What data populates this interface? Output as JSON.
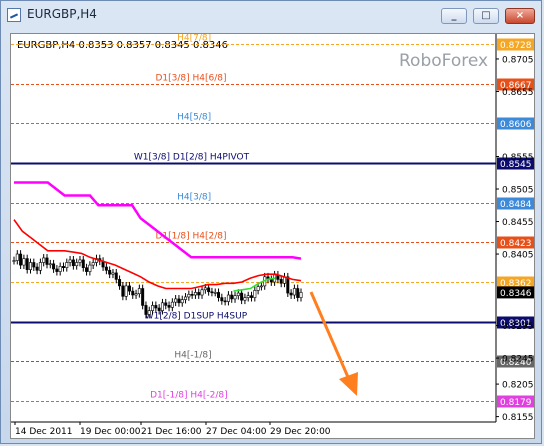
{
  "window": {
    "title": "EURGBP,H4",
    "buttons": [
      "minimize",
      "maximize",
      "close"
    ]
  },
  "chart": {
    "symbol_info": "EURGBP,H4  0.8353 0.8357 0.8345 0.8346",
    "watermark": "RoboForex",
    "current_price": "0.8346"
  },
  "chart_data": {
    "type": "line",
    "y_ticks": [
      "0.8705",
      "0.8655",
      "0.8555",
      "0.8505",
      "0.8455",
      "0.8405",
      "0.8295",
      "0.8245",
      "0.8205",
      "0.8155"
    ],
    "x_ticks": [
      "14 Dec 2011",
      "19 Dec 00:00",
      "21 Dec 16:00",
      "27 Dec 04:00",
      "29 Dec 20:00"
    ],
    "ylim": [
      0.8135,
      0.8745
    ],
    "levels": [
      {
        "label": "H4[7/8]",
        "value": 0.8728,
        "price": "0.8728",
        "color": "#f5a623",
        "style": "dashed"
      },
      {
        "label": "D1[3/8] H4[6/8]",
        "value": 0.8667,
        "price": "0.8667",
        "color": "#e8501a",
        "style": "dashed"
      },
      {
        "label": "H4[5/8]",
        "value": 0.8606,
        "price": "0.8606",
        "color": "#3c8ad8",
        "style": "dashed"
      },
      {
        "label": "W1[3/8] D1[2/8] H4PIVOT",
        "value": 0.8545,
        "price": "0.8545",
        "color": "#0c0c6e",
        "style": "solid"
      },
      {
        "label": "H4[3/8]",
        "value": 0.8484,
        "price": "0.8484",
        "color": "#3c8ad8",
        "style": "dashed"
      },
      {
        "label": "D1[1/8] H4[2/8]",
        "value": 0.8423,
        "price": "0.8423",
        "color": "#e8501a",
        "style": "dashed"
      },
      {
        "label": "",
        "value": 0.8362,
        "price": "0.8362",
        "color": "#f5a623",
        "style": "dashed"
      },
      {
        "label": "W1[2/8] D1SUP H4SUP",
        "value": 0.8301,
        "price": "0.8301",
        "color": "#0c0c6e",
        "style": "solid"
      },
      {
        "label": "H4[-1/8]",
        "value": 0.824,
        "price": "0.8240",
        "color": "#666666",
        "style": "dashed"
      },
      {
        "label": "D1[-1/8] H4[-2/8]",
        "value": 0.8179,
        "price": "0.8179",
        "color": "#e040e0",
        "style": "dashed"
      }
    ],
    "price_series": [
      0.8395,
      0.8405,
      0.8388,
      0.8398,
      0.8381,
      0.8392,
      0.8385,
      0.838,
      0.8392,
      0.8399,
      0.8389,
      0.839,
      0.8382,
      0.8378,
      0.8386,
      0.8384,
      0.8392,
      0.8396,
      0.8387,
      0.8392,
      0.8396,
      0.8384,
      0.8378,
      0.8388,
      0.8392,
      0.8398,
      0.8394,
      0.8385,
      0.838,
      0.8374,
      0.8376,
      0.8366,
      0.8356,
      0.834,
      0.8356,
      0.8348,
      0.8342,
      0.8344,
      0.8352,
      0.8326,
      0.8312,
      0.8318,
      0.8326,
      0.8322,
      0.8318,
      0.833,
      0.8326,
      0.8323,
      0.8331,
      0.8336,
      0.833,
      0.8335,
      0.8339,
      0.8343,
      0.8342,
      0.8346,
      0.8342,
      0.835,
      0.8353,
      0.8347,
      0.8346,
      0.8346,
      0.8338,
      0.8333,
      0.8332,
      0.8342,
      0.8336,
      0.8341,
      0.8345,
      0.8334,
      0.8338,
      0.8341,
      0.8338,
      0.8349,
      0.8355,
      0.8356,
      0.837,
      0.8366,
      0.8362,
      0.8373,
      0.8366,
      0.836,
      0.837,
      0.8345,
      0.8342,
      0.8352,
      0.8338,
      0.8346
    ],
    "series": [
      {
        "color": "#ff00ff",
        "values": [
          0.8515,
          0.8515,
          0.8515,
          0.8515,
          0.8515,
          0.8505,
          0.8495,
          0.8495,
          0.8495,
          0.8495,
          0.848,
          0.848,
          0.848,
          0.848,
          0.848,
          0.846,
          0.845,
          0.844,
          0.843,
          0.842,
          0.841,
          0.84,
          0.84,
          0.84,
          0.84,
          0.84,
          0.84,
          0.84,
          0.84,
          0.84,
          0.84,
          0.84,
          0.84,
          0.84,
          0.8398
        ]
      },
      {
        "color": "#ff0000",
        "values": [
          0.8458,
          0.844,
          0.843,
          0.842,
          0.841,
          0.841,
          0.841,
          0.8408,
          0.8406,
          0.84,
          0.8396,
          0.8392,
          0.8388,
          0.8382,
          0.8376,
          0.837,
          0.8362,
          0.8356,
          0.8352,
          0.8352,
          0.8352,
          0.8352,
          0.8355,
          0.8358,
          0.8358,
          0.836,
          0.836,
          0.8362,
          0.8368,
          0.8372,
          0.8374,
          0.8374,
          0.837,
          0.8366,
          0.8364
        ]
      },
      {
        "color": "#33dd33",
        "values": [
          null,
          null,
          null,
          null,
          null,
          null,
          null,
          null,
          null,
          null,
          null,
          null,
          null,
          null,
          null,
          null,
          null,
          null,
          null,
          null,
          null,
          null,
          null,
          null,
          null,
          null,
          0.8348,
          0.835,
          0.8352,
          0.836,
          0.8366,
          0.8368,
          null,
          null,
          null
        ]
      }
    ]
  }
}
